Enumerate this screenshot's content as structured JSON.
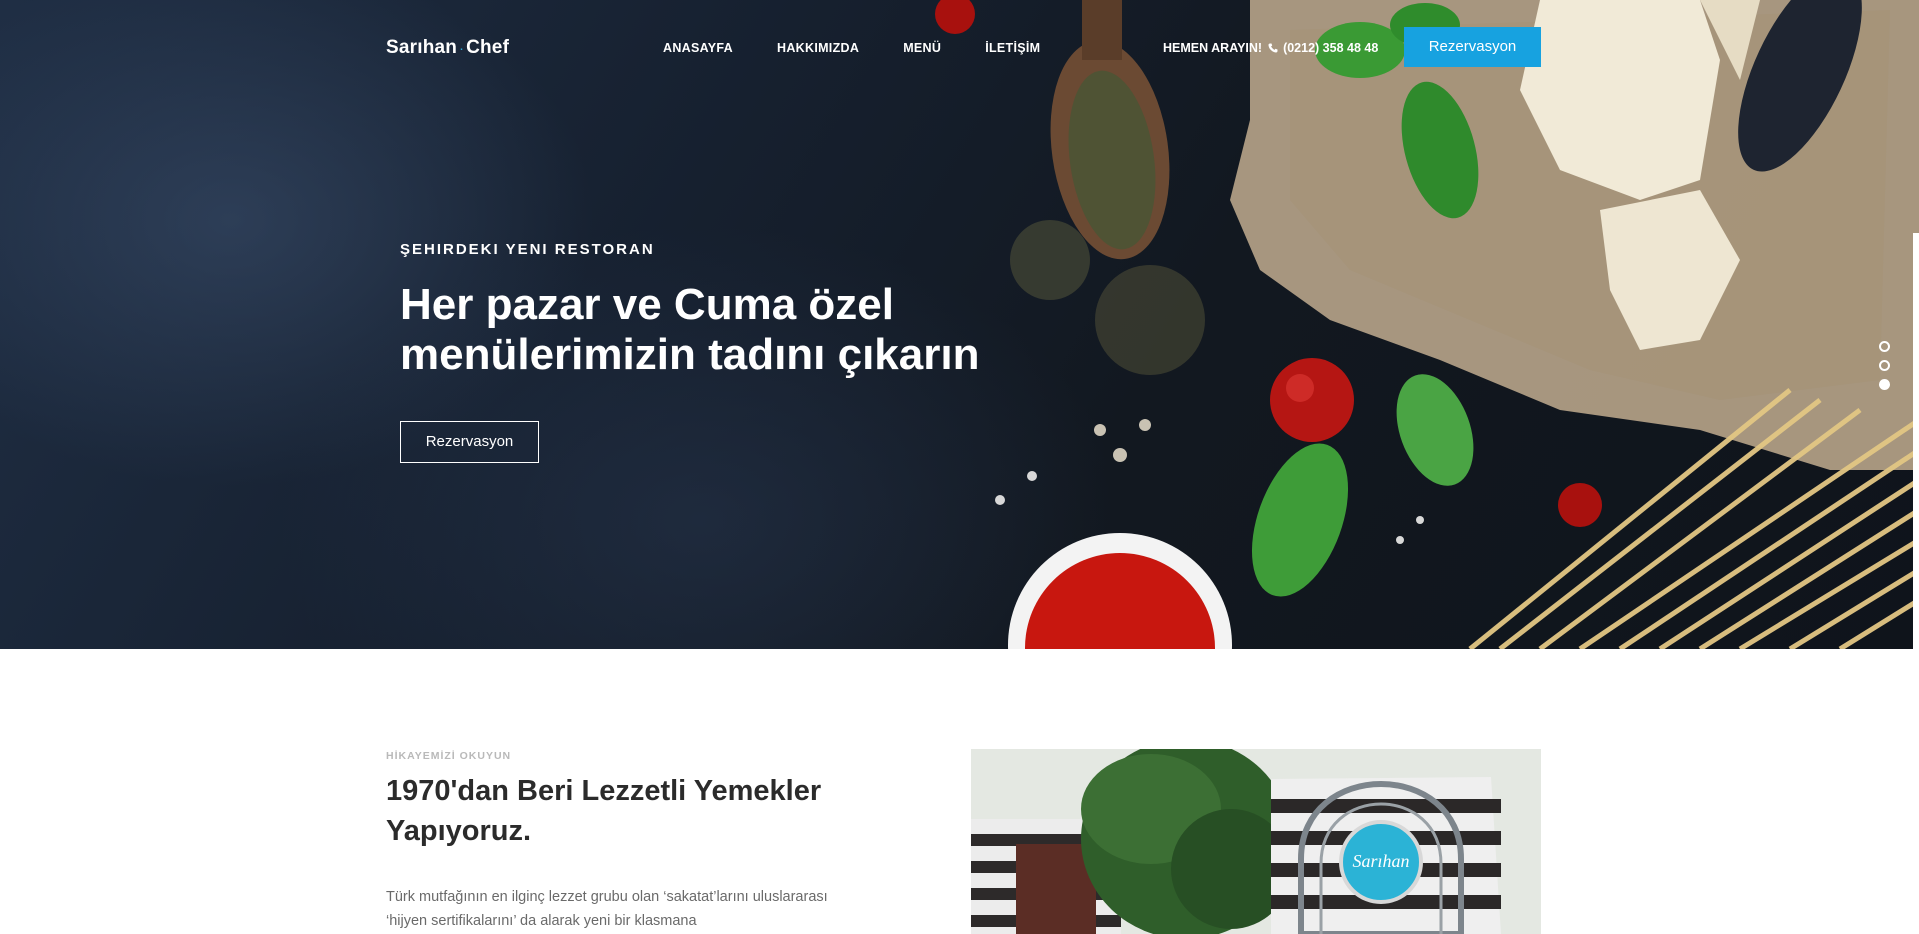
{
  "brand": {
    "name_left": "Sarıhan",
    "separator": ".",
    "name_right": "Chef"
  },
  "nav": {
    "items": [
      {
        "label": "ANASAYFA"
      },
      {
        "label": "HAKKIMIZDA"
      },
      {
        "label": "MENÜ"
      },
      {
        "label": "İLETİŞİM"
      }
    ],
    "phone_label": "HEMEN ARAYIN!",
    "phone_number": "(0212) 358 48 48",
    "phone_icon": "phone-icon",
    "cta_label": "Rezervasyon"
  },
  "hero": {
    "eyebrow": "ŞEHIRDEKI YENI RESTORAN",
    "headline": "Her pazar ve Cuma özel menülerimizin tadını çıkarın",
    "button_label": "Rezervasyon",
    "slide_count": 3,
    "active_slide": 3
  },
  "about": {
    "kicker": "HİKAYEMİZİ OKUYUN",
    "title": "1970'dan Beri Lezzetli Yemekler Yapıyoruz.",
    "text": "Türk mutfağının en ilginç lezzet grubu olan ‘sakatat’larını uluslararası ‘hijyen sertifikalarını’ da alarak yeni bir klasmana",
    "image_sign_text": "Sarıhan"
  },
  "colors": {
    "accent": "#17a2e0",
    "hero_dark": "#121820",
    "text_dark": "#2b2b2b",
    "text_muted": "#6a6a6a"
  }
}
